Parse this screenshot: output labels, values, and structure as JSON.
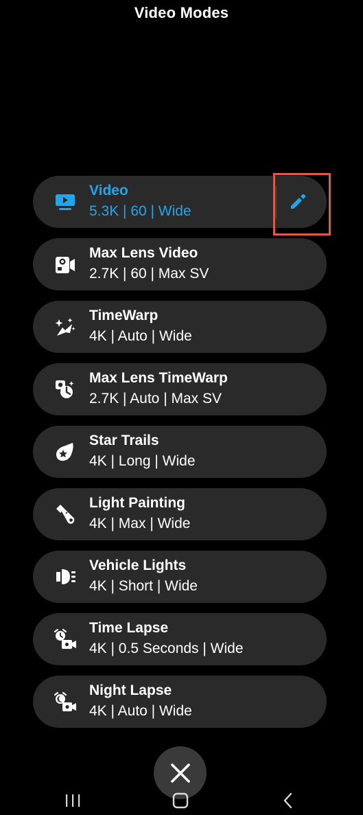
{
  "header": {
    "title": "Video Modes"
  },
  "modes": [
    {
      "name": "Video",
      "settings": "5.3K | 60 | Wide",
      "icon": "monitor-icon",
      "active": true
    },
    {
      "name": "Max Lens Video",
      "settings": "2.7K | 60 | Max SV",
      "icon": "max-lens-camera-icon"
    },
    {
      "name": "TimeWarp",
      "settings": "4K | Auto | Wide",
      "icon": "timewarp-icon"
    },
    {
      "name": "Max Lens TimeWarp",
      "settings": "2.7K | Auto | Max SV",
      "icon": "max-lens-timewarp-icon"
    },
    {
      "name": "Star Trails",
      "settings": "4K | Long | Wide",
      "icon": "star-trails-icon"
    },
    {
      "name": "Light Painting",
      "settings": "4K | Max | Wide",
      "icon": "flashlight-icon"
    },
    {
      "name": "Vehicle Lights",
      "settings": "4K | Short | Wide",
      "icon": "headlight-icon"
    },
    {
      "name": "Time Lapse",
      "settings": "4K | 0.5 Seconds | Wide",
      "icon": "time-lapse-icon"
    },
    {
      "name": "Night Lapse",
      "settings": "4K | Auto | Wide",
      "icon": "night-lapse-icon"
    }
  ],
  "colors": {
    "background": "#000000",
    "card": "#2a2a2a",
    "accent": "#1ea7ef",
    "highlight": "#e5574d"
  },
  "icons": {
    "edit": "pencil-icon",
    "close": "close-icon",
    "nav_recents": "recents-icon",
    "nav_home": "home-icon",
    "nav_back": "back-icon"
  }
}
